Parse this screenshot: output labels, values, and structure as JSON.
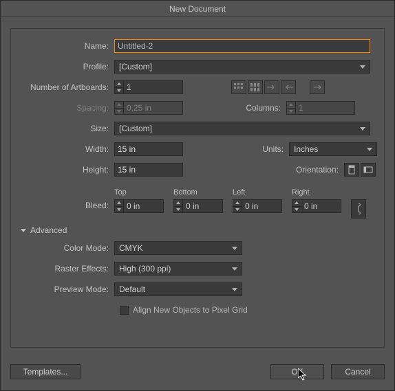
{
  "title": "New Document",
  "name": {
    "label": "Name:",
    "value": "Untitled-2"
  },
  "profile": {
    "label": "Profile:",
    "value": "[Custom]"
  },
  "artboards": {
    "label": "Number of Artboards:",
    "value": "1",
    "spacing_label": "Spacing:",
    "spacing_value": "0,25 in",
    "columns_label": "Columns:",
    "columns_value": "1"
  },
  "size": {
    "label": "Size:",
    "value": "[Custom]"
  },
  "width": {
    "label": "Width:",
    "value": "15 in"
  },
  "height": {
    "label": "Height:",
    "value": "15 in"
  },
  "units": {
    "label": "Units:",
    "value": "Inches"
  },
  "orientation": {
    "label": "Orientation:"
  },
  "bleed": {
    "label": "Bleed:",
    "top_label": "Top",
    "top_value": "0 in",
    "bottom_label": "Bottom",
    "bottom_value": "0 in",
    "left_label": "Left",
    "left_value": "0 in",
    "right_label": "Right",
    "right_value": "0 in"
  },
  "advanced": {
    "label": "Advanced"
  },
  "colormode": {
    "label": "Color Mode:",
    "value": "CMYK"
  },
  "raster": {
    "label": "Raster Effects:",
    "value": "High (300 ppi)"
  },
  "preview": {
    "label": "Preview Mode:",
    "value": "Default"
  },
  "align_grid": {
    "label": "Align New Objects to Pixel Grid"
  },
  "footer": {
    "templates": "Templates...",
    "ok": "OK",
    "cancel": "Cancel"
  }
}
